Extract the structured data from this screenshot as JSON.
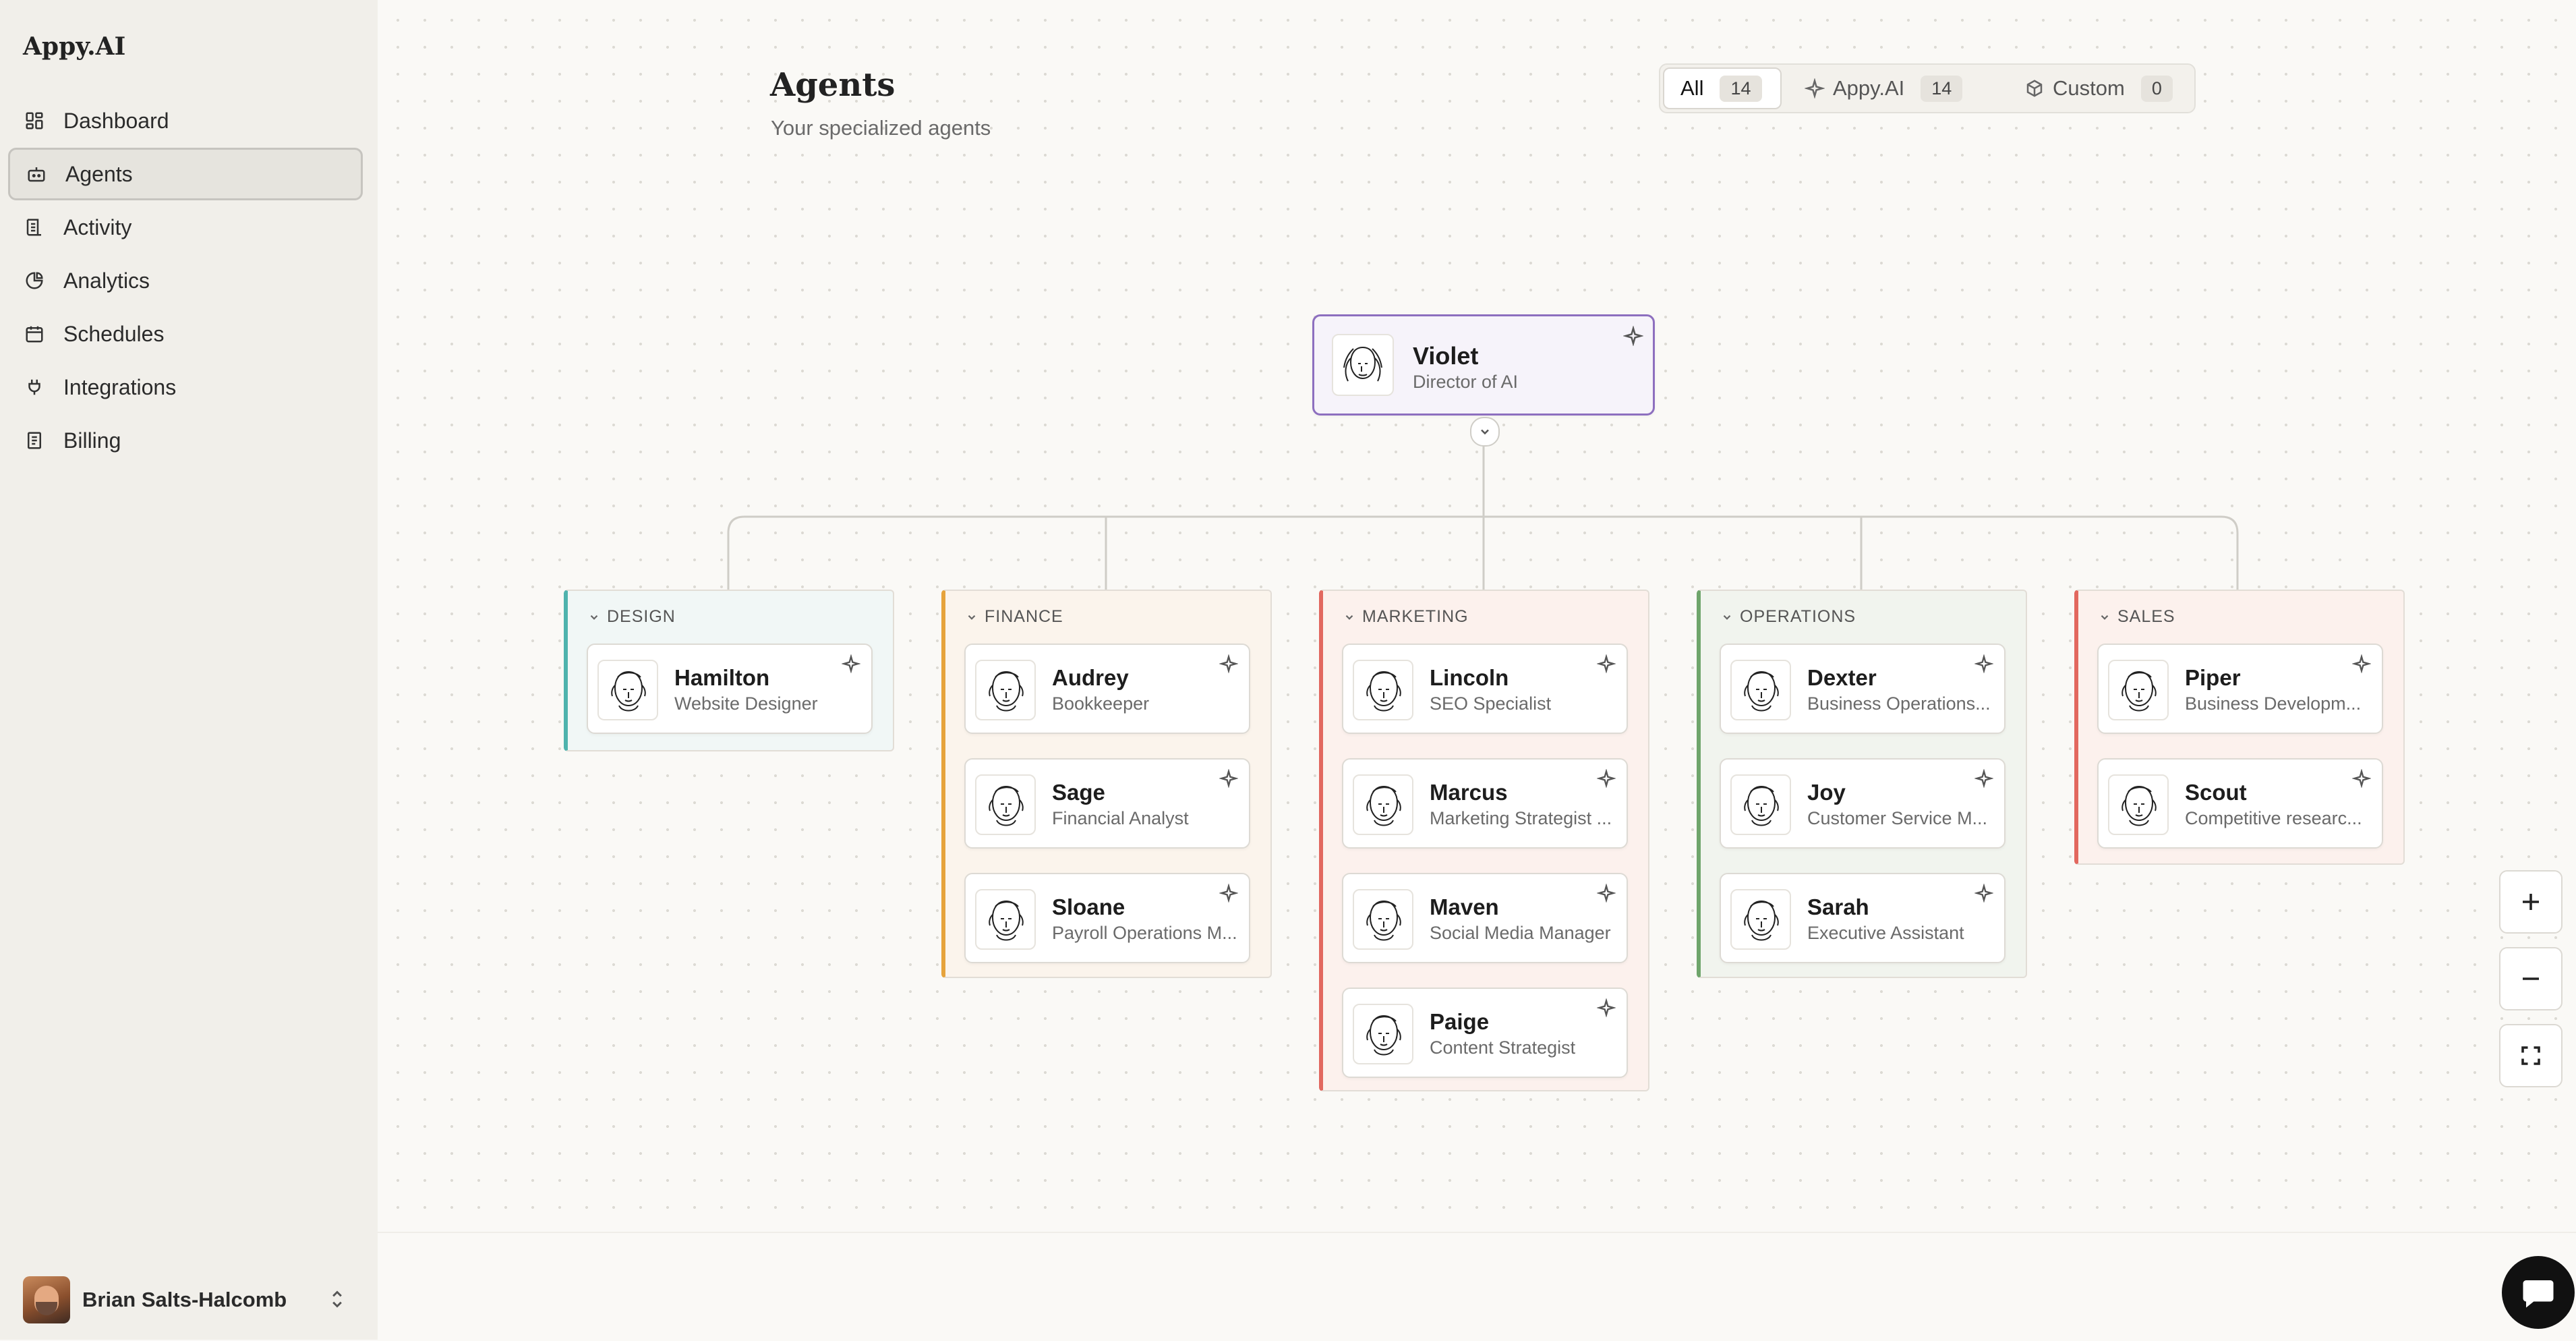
{
  "app": {
    "logo": "Appy.AI"
  },
  "sidebar": {
    "items": [
      {
        "label": "Dashboard",
        "icon": "dashboard-icon"
      },
      {
        "label": "Agents",
        "icon": "bot-icon",
        "active": true
      },
      {
        "label": "Activity",
        "icon": "activity-icon"
      },
      {
        "label": "Analytics",
        "icon": "pie-chart-icon"
      },
      {
        "label": "Schedules",
        "icon": "calendar-icon"
      },
      {
        "label": "Integrations",
        "icon": "plug-icon"
      },
      {
        "label": "Billing",
        "icon": "receipt-icon"
      }
    ],
    "user": {
      "name": "Brian Salts-Halcomb"
    }
  },
  "header": {
    "title": "Agents",
    "subtitle": "Your specialized agents"
  },
  "filters": [
    {
      "label": "All",
      "count": "14",
      "active": true
    },
    {
      "label": "Appy.AI",
      "count": "14",
      "icon": "sparkle-icon"
    },
    {
      "label": "Custom",
      "count": "0",
      "icon": "box-icon"
    }
  ],
  "director": {
    "name": "Violet",
    "role": "Director of AI"
  },
  "departments": [
    {
      "label": "DESIGN",
      "color": "#4fb3ad",
      "bg": "#f1f7f6",
      "agents": [
        {
          "name": "Hamilton",
          "role": "Website Designer"
        }
      ]
    },
    {
      "label": "FINANCE",
      "color": "#e6a33c",
      "bg": "#fbf4ec",
      "agents": [
        {
          "name": "Audrey",
          "role": "Bookkeeper"
        },
        {
          "name": "Sage",
          "role": "Financial Analyst"
        },
        {
          "name": "Sloane",
          "role": "Payroll Operations M..."
        }
      ]
    },
    {
      "label": "MARKETING",
      "color": "#e2685f",
      "bg": "#fcf1ed",
      "agents": [
        {
          "name": "Lincoln",
          "role": "SEO Specialist"
        },
        {
          "name": "Marcus",
          "role": "Marketing Strategist ..."
        },
        {
          "name": "Maven",
          "role": "Social Media Manager"
        },
        {
          "name": "Paige",
          "role": "Content Strategist"
        }
      ]
    },
    {
      "label": "OPERATIONS",
      "color": "#6fa56b",
      "bg": "#f1f4ee",
      "agents": [
        {
          "name": "Dexter",
          "role": "Business Operations..."
        },
        {
          "name": "Joy",
          "role": "Customer Service M..."
        },
        {
          "name": "Sarah",
          "role": "Executive Assistant"
        }
      ]
    },
    {
      "label": "SALES",
      "color": "#e2685f",
      "bg": "#fcf1ed",
      "agents": [
        {
          "name": "Piper",
          "role": "Business Developm..."
        },
        {
          "name": "Scout",
          "role": "Competitive researc..."
        }
      ]
    }
  ],
  "zoom_controls": [
    "zoom-in",
    "zoom-out",
    "fit-view"
  ]
}
